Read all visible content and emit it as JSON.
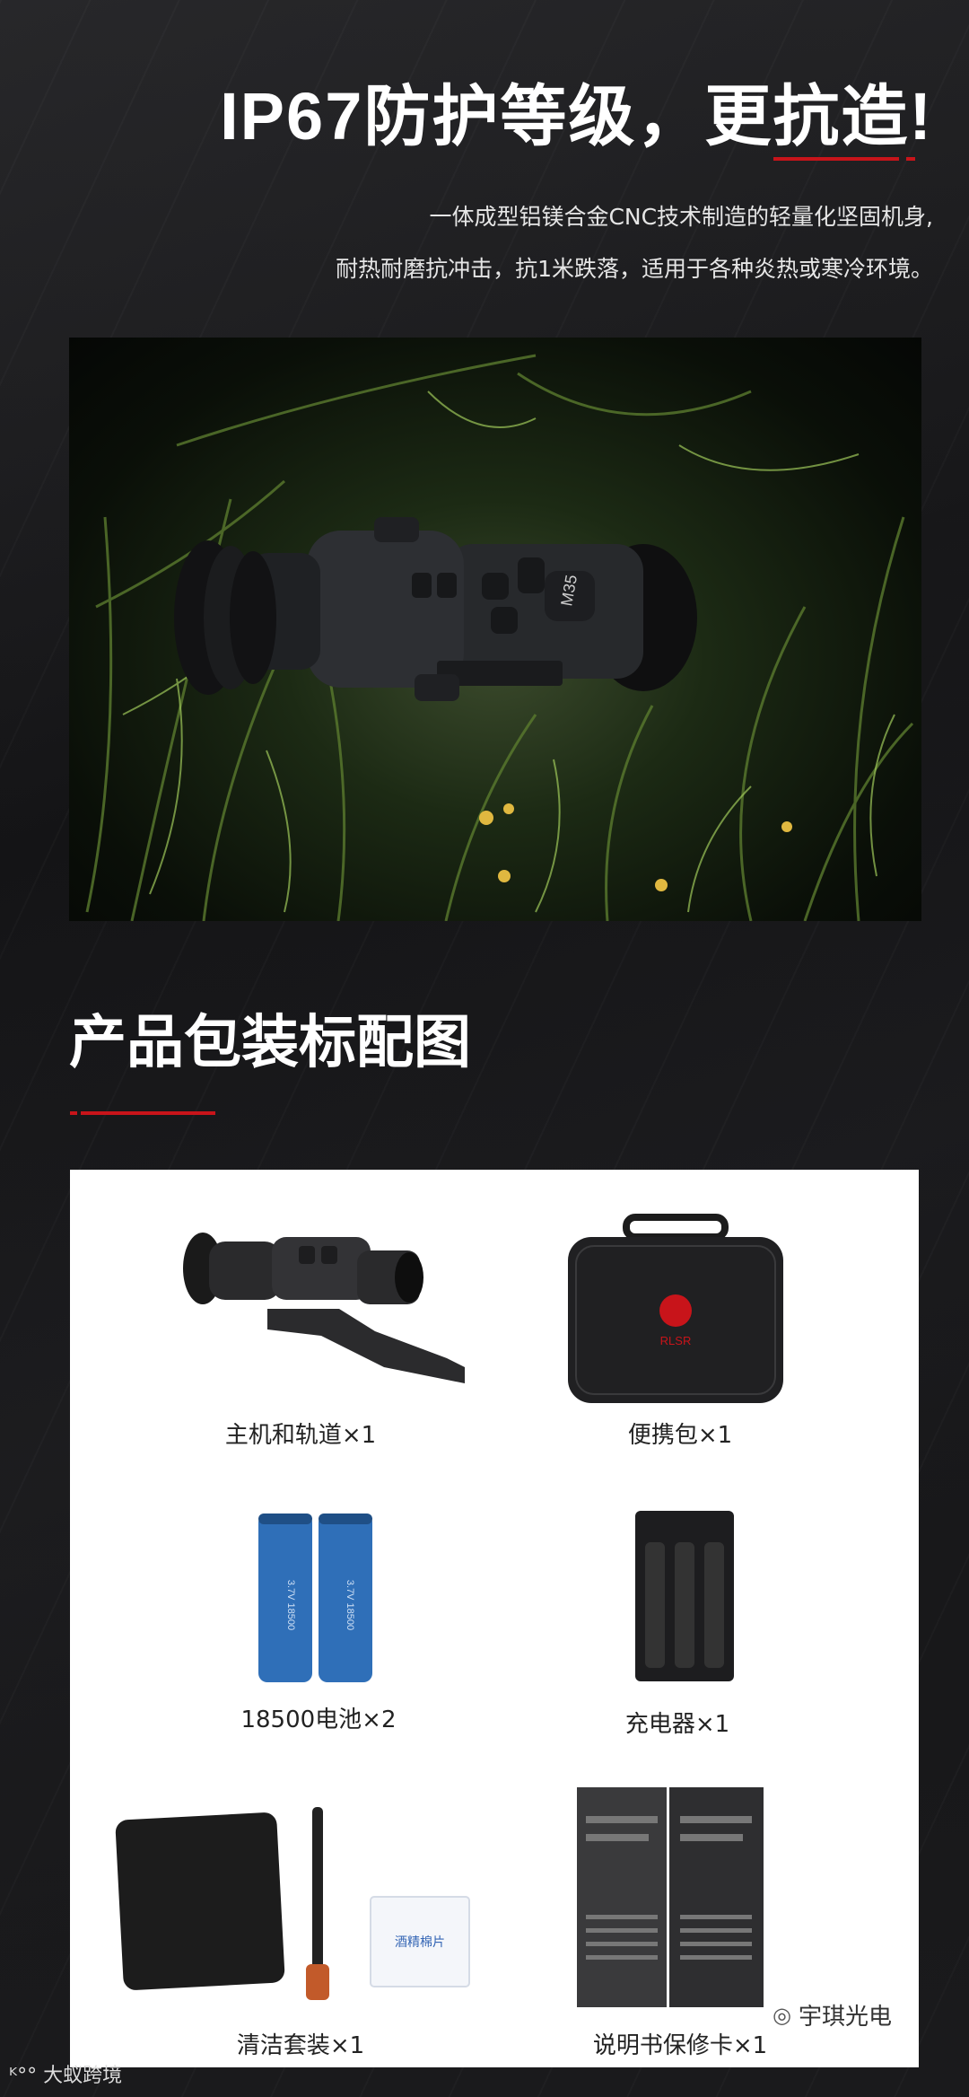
{
  "hero": {
    "title": "IP67防护等级，更抗造!",
    "desc_line1": "一体成型铝镁合金CNC技术制造的轻量化坚固机身,",
    "desc_line2": "耐热耐磨抗冲击，抗1米跌落，适用于各种炎热或寒冷环境。"
  },
  "photo": {
    "scope_marking": "M35"
  },
  "section": {
    "title": "产品包装标配图"
  },
  "items": [
    {
      "label": "主机和轨道×1"
    },
    {
      "label": "便携包×1"
    },
    {
      "label": "18500电池×2"
    },
    {
      "label": "充电器×1"
    },
    {
      "label": "清洁套装×1"
    },
    {
      "label": "说明书保修卡×1"
    }
  ],
  "item_text": {
    "case_brand": "RLSR",
    "battery_print": "3.7V 18500",
    "wipe_text": "酒精棉片"
  },
  "watermarks": {
    "left": "大蚁跨境",
    "right": "宇琪光电"
  },
  "colors": {
    "accent_red": "#c8141a",
    "background": "#1a1a1c",
    "panel": "#ffffff"
  }
}
